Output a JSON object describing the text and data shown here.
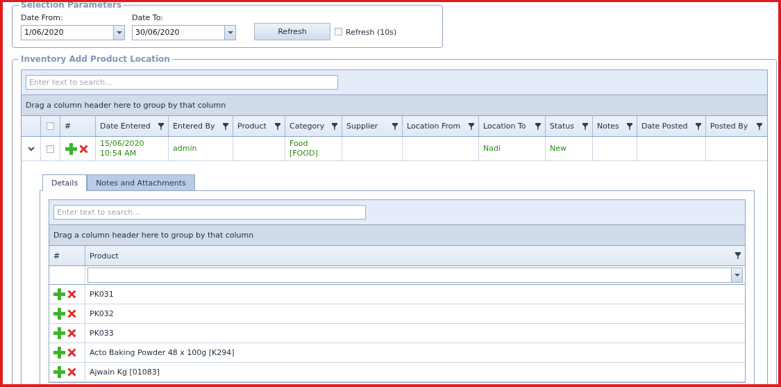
{
  "selection_parameters": {
    "title": "Selection Parameters",
    "date_from": {
      "label": "Date From:",
      "value": "1/06/2020"
    },
    "date_to": {
      "label": "Date To:",
      "value": "30/06/2020"
    },
    "refresh_button": "Refresh",
    "auto_refresh": {
      "label": "Refresh (10s)",
      "checked": false
    }
  },
  "inventory": {
    "title": "Inventory Add Product Location",
    "search": {
      "placeholder": "Enter text to search..."
    },
    "group_panel": "Drag a column header here to group by that column",
    "select_all_checked": false,
    "columns": [
      {
        "label": "Date Entered"
      },
      {
        "label": "Entered By"
      },
      {
        "label": "Product"
      },
      {
        "label": "Category"
      },
      {
        "label": "Supplier"
      },
      {
        "label": "Location From"
      },
      {
        "label": "Location To"
      },
      {
        "label": "Status"
      },
      {
        "label": "Notes"
      },
      {
        "label": "Date Posted"
      },
      {
        "label": "Posted By"
      }
    ],
    "number_column": "#",
    "rows": [
      {
        "expanded": true,
        "checked": false,
        "cells": [
          "15/06/2020\n10:54 AM",
          "admin",
          null,
          "Food\n[FOOD]",
          null,
          null,
          "Nadi",
          "New",
          null,
          null,
          null
        ]
      }
    ],
    "detail": {
      "tabs": [
        {
          "label": "Details",
          "selected": true
        },
        {
          "label": "Notes and Attachments",
          "selected": false
        }
      ],
      "search": {
        "placeholder": "Enter text to search..."
      },
      "group_panel": "Drag a column header here to group by that column",
      "number_column": "#",
      "product_column": "Product",
      "rows": [
        {
          "product": "PK031"
        },
        {
          "product": "PK032"
        },
        {
          "product": "PK033"
        },
        {
          "product": "Acto Baking Powder 48 x 100g [K294]"
        },
        {
          "product": "Ajwain Kg [01083]"
        }
      ]
    }
  }
}
